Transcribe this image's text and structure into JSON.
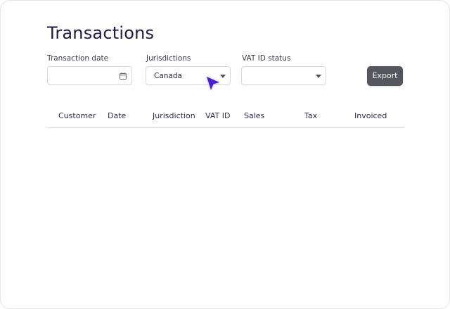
{
  "page": {
    "title": "Transactions"
  },
  "filters": {
    "transaction_date": {
      "label": "Transaction date",
      "value": "",
      "icon": "calendar-icon"
    },
    "jurisdictions": {
      "label": "Jurisdictions",
      "value": "Canada",
      "icon": "chevron-down-icon"
    },
    "vat_id_status": {
      "label": "VAT ID status",
      "value": "",
      "icon": "chevron-down-icon"
    }
  },
  "actions": {
    "export_label": "Export"
  },
  "table": {
    "columns": [
      "Customer",
      "Date",
      "Jurisdiction",
      "VAT ID",
      "Sales",
      "Tax",
      "Invoiced"
    ],
    "rows": []
  },
  "colors": {
    "title": "#1f1a4d",
    "export_button": "#56565e",
    "cursor": "#4a1fd6"
  }
}
